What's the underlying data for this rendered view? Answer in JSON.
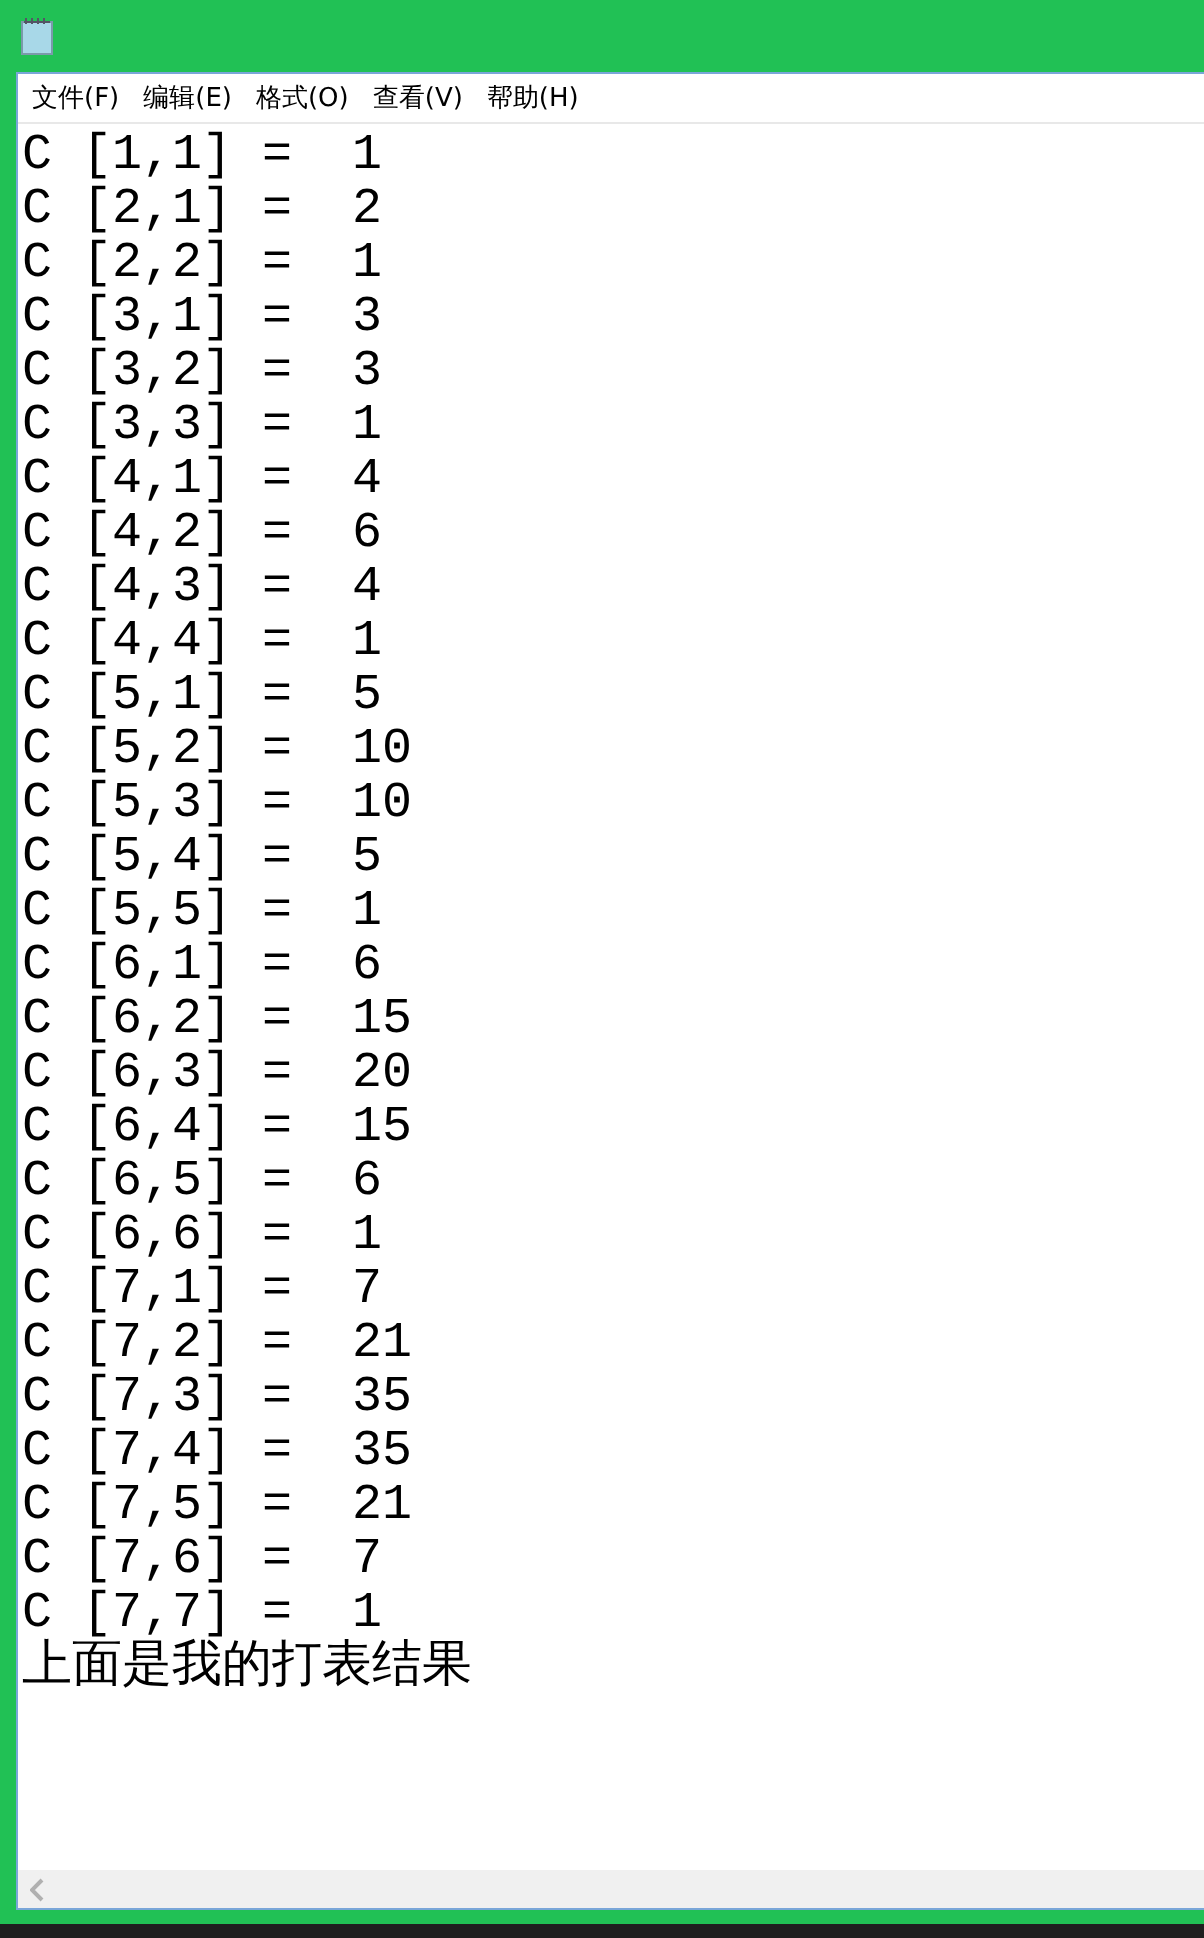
{
  "menu": [
    {
      "label": "文件(F)"
    },
    {
      "label": "编辑(E)"
    },
    {
      "label": "格式(O)"
    },
    {
      "label": "查看(V)"
    },
    {
      "label": "帮助(H)"
    }
  ],
  "document": {
    "lines": [
      "C [1,1] =  1",
      "C [2,1] =  2",
      "C [2,2] =  1",
      "C [3,1] =  3",
      "C [3,2] =  3",
      "C [3,3] =  1",
      "C [4,1] =  4",
      "C [4,2] =  6",
      "C [4,3] =  4",
      "C [4,4] =  1",
      "C [5,1] =  5",
      "C [5,2] =  10",
      "C [5,3] =  10",
      "C [5,4] =  5",
      "C [5,5] =  1",
      "C [6,1] =  6",
      "C [6,2] =  15",
      "C [6,3] =  20",
      "C [6,4] =  15",
      "C [6,5] =  6",
      "C [6,6] =  1",
      "C [7,1] =  7",
      "C [7,2] =  21",
      "C [7,3] =  35",
      "C [7,4] =  35",
      "C [7,5] =  21",
      "C [7,6] =  7",
      "C [7,7] =  1",
      "上面是我的打表结果"
    ]
  }
}
